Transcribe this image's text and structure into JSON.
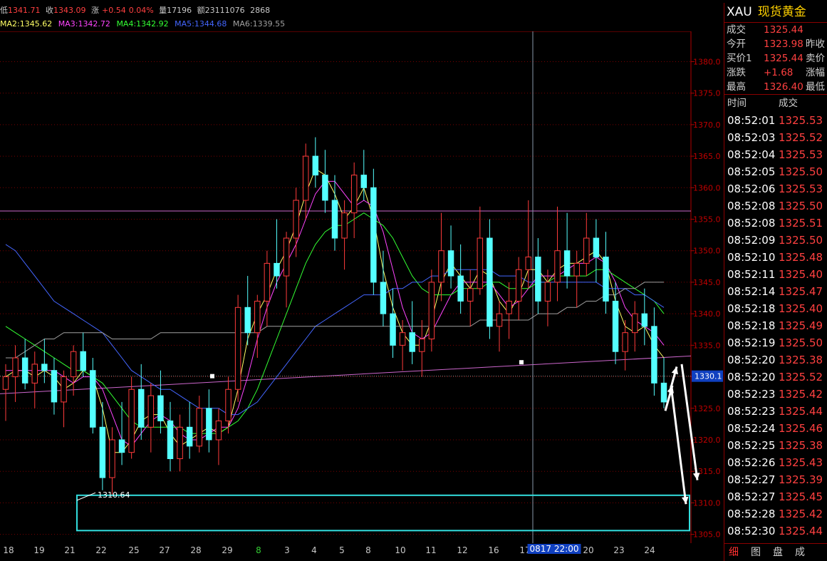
{
  "topbar": {
    "low_label": "低",
    "low_value": "1341.71",
    "close_label": "收",
    "close_value": "1343.09",
    "change_label": "涨",
    "change_value": "+0.54",
    "change_pct": "0.04%",
    "volume_label": "量",
    "volume_value": "17196",
    "amount_label": "额",
    "amount_value": "23111076",
    "extra_value": "2868"
  },
  "ma_bar": [
    {
      "label": "MA2:1345.62",
      "color": "#ffff66"
    },
    {
      "label": "MA3:1342.72",
      "color": "#ff44ff"
    },
    {
      "label": "MA4:1342.92",
      "color": "#33ff33"
    },
    {
      "label": "MA5:1344.68",
      "color": "#4466ff"
    },
    {
      "label": "MA6:1339.55",
      "color": "#a0a0a0"
    }
  ],
  "chart_data": {
    "type": "candlestick",
    "y_ticks": [
      1305.0,
      1310.0,
      1315.0,
      1320.0,
      1325.0,
      1330.0,
      1335.0,
      1340.0,
      1345.0,
      1350.0,
      1355.0,
      1360.0,
      1365.0,
      1370.0,
      1375.0,
      1380.0
    ],
    "ylim": [
      1303.6,
      1384.8
    ],
    "x_ticks": [
      "18",
      "19",
      "21",
      "22",
      "25",
      "27",
      "28",
      "29",
      "8",
      "3",
      "4",
      "5",
      "8",
      "10",
      "11",
      "12",
      "16",
      "17",
      "20",
      "23",
      "24"
    ],
    "x_tick_highlight": "8",
    "cursor_label": "0817 22:00",
    "current_price_label": "1330.1",
    "low_annotation": "1310.64",
    "candles": [
      [
        1328,
        1332,
        1323,
        1330
      ],
      [
        1330,
        1335,
        1326,
        1333
      ],
      [
        1333,
        1336,
        1328,
        1329
      ],
      [
        1329,
        1334,
        1325,
        1332
      ],
      [
        1332,
        1336,
        1329,
        1331
      ],
      [
        1331,
        1333,
        1324,
        1326
      ],
      [
        1326,
        1331,
        1322,
        1330
      ],
      [
        1330,
        1335,
        1327,
        1334
      ],
      [
        1334,
        1337,
        1330,
        1331
      ],
      [
        1331,
        1333,
        1321,
        1322
      ],
      [
        1322,
        1326,
        1312,
        1314
      ],
      [
        1314,
        1322,
        1311,
        1320
      ],
      [
        1320,
        1326,
        1316,
        1318
      ],
      [
        1318,
        1330,
        1317,
        1328
      ],
      [
        1328,
        1332,
        1320,
        1322
      ],
      [
        1322,
        1329,
        1318,
        1327
      ],
      [
        1327,
        1331,
        1321,
        1323
      ],
      [
        1323,
        1326,
        1315,
        1317
      ],
      [
        1317,
        1324,
        1315,
        1322
      ],
      [
        1322,
        1326,
        1317,
        1319
      ],
      [
        1319,
        1327,
        1318,
        1325
      ],
      [
        1325,
        1328,
        1318,
        1320
      ],
      [
        1320,
        1325,
        1316,
        1323
      ],
      [
        1323,
        1330,
        1321,
        1328
      ],
      [
        1328,
        1343,
        1326,
        1341
      ],
      [
        1341,
        1346,
        1335,
        1337
      ],
      [
        1337,
        1343,
        1333,
        1342
      ],
      [
        1342,
        1350,
        1338,
        1348
      ],
      [
        1348,
        1355,
        1344,
        1346
      ],
      [
        1346,
        1353,
        1341,
        1352
      ],
      [
        1352,
        1360,
        1349,
        1358
      ],
      [
        1358,
        1367,
        1355,
        1365
      ],
      [
        1365,
        1368,
        1360,
        1362
      ],
      [
        1362,
        1366,
        1356,
        1358
      ],
      [
        1358,
        1362,
        1350,
        1352
      ],
      [
        1352,
        1358,
        1347,
        1356
      ],
      [
        1356,
        1364,
        1352,
        1362
      ],
      [
        1362,
        1366,
        1358,
        1360
      ],
      [
        1360,
        1363,
        1343,
        1345
      ],
      [
        1345,
        1350,
        1338,
        1340
      ],
      [
        1340,
        1344,
        1333,
        1335
      ],
      [
        1335,
        1339,
        1331,
        1337
      ],
      [
        1337,
        1342,
        1332,
        1334
      ],
      [
        1334,
        1339,
        1330,
        1336
      ],
      [
        1336,
        1347,
        1334,
        1345
      ],
      [
        1345,
        1356,
        1342,
        1350
      ],
      [
        1350,
        1354,
        1344,
        1346
      ],
      [
        1346,
        1351,
        1340,
        1342
      ],
      [
        1342,
        1347,
        1338,
        1344
      ],
      [
        1344,
        1357,
        1343,
        1352
      ],
      [
        1352,
        1355,
        1336,
        1338
      ],
      [
        1338,
        1342,
        1334,
        1340
      ],
      [
        1340,
        1345,
        1336,
        1342
      ],
      [
        1342,
        1349,
        1339,
        1347
      ],
      [
        1347,
        1358,
        1344,
        1349
      ],
      [
        1349,
        1352,
        1340,
        1342
      ],
      [
        1342,
        1347,
        1338,
        1345
      ],
      [
        1345,
        1357,
        1342,
        1350
      ],
      [
        1350,
        1356,
        1344,
        1346
      ],
      [
        1346,
        1350,
        1341,
        1348
      ],
      [
        1348,
        1356,
        1346,
        1352
      ],
      [
        1352,
        1355,
        1345,
        1349
      ],
      [
        1349,
        1353,
        1340,
        1342
      ],
      [
        1342,
        1345,
        1332,
        1334
      ],
      [
        1334,
        1339,
        1331,
        1337
      ],
      [
        1337,
        1342,
        1334,
        1340
      ],
      [
        1340,
        1344,
        1335,
        1338
      ],
      [
        1338,
        1341,
        1327,
        1329
      ],
      [
        1329,
        1333,
        1325,
        1326
      ]
    ],
    "ma_series": [
      {
        "name": "MA2",
        "color": "#ffff66",
        "values": [
          1330,
          1331,
          1331,
          1330,
          1331,
          1330,
          1328,
          1329,
          1331,
          1330,
          1325,
          1318,
          1318,
          1320,
          1323,
          1324,
          1324,
          1321,
          1319,
          1320,
          1321,
          1322,
          1321,
          1322,
          1328,
          1336,
          1340,
          1343,
          1347,
          1350,
          1354,
          1359,
          1363,
          1362,
          1359,
          1355,
          1357,
          1360,
          1355,
          1347,
          1341,
          1337,
          1335,
          1335,
          1339,
          1345,
          1348,
          1346,
          1344,
          1347,
          1346,
          1342,
          1340,
          1343,
          1347,
          1347,
          1345,
          1347,
          1348,
          1348,
          1349,
          1350,
          1348,
          1342,
          1338,
          1337,
          1338,
          1335,
          1333
        ]
      },
      {
        "name": "MA3",
        "color": "#ff44ff",
        "values": [
          1331,
          1331,
          1331,
          1331,
          1331,
          1331,
          1330,
          1329,
          1330,
          1330,
          1328,
          1324,
          1320,
          1319,
          1321,
          1323,
          1324,
          1323,
          1321,
          1320,
          1320,
          1321,
          1322,
          1322,
          1325,
          1330,
          1336,
          1341,
          1345,
          1348,
          1351,
          1355,
          1359,
          1361,
          1361,
          1359,
          1357,
          1358,
          1357,
          1353,
          1347,
          1341,
          1337,
          1336,
          1337,
          1340,
          1343,
          1345,
          1345,
          1345,
          1345,
          1343,
          1341,
          1342,
          1344,
          1346,
          1346,
          1346,
          1347,
          1348,
          1348,
          1349,
          1348,
          1345,
          1341,
          1339,
          1338,
          1337,
          1335
        ]
      },
      {
        "name": "MA4",
        "color": "#33ff33",
        "values": [
          1338,
          1337,
          1336,
          1335,
          1334,
          1333,
          1332,
          1331,
          1331,
          1330,
          1329,
          1327,
          1325,
          1323,
          1322,
          1322,
          1322,
          1322,
          1322,
          1321,
          1321,
          1321,
          1321,
          1322,
          1323,
          1325,
          1328,
          1332,
          1336,
          1340,
          1344,
          1348,
          1351,
          1353,
          1354,
          1354,
          1355,
          1356,
          1355,
          1354,
          1352,
          1349,
          1346,
          1344,
          1343,
          1343,
          1343,
          1344,
          1344,
          1344,
          1345,
          1345,
          1344,
          1344,
          1344,
          1345,
          1345,
          1346,
          1346,
          1346,
          1346,
          1347,
          1347,
          1346,
          1345,
          1344,
          1343,
          1342,
          1340
        ]
      },
      {
        "name": "MA5",
        "color": "#4466ff",
        "values": [
          1351,
          1350,
          1348,
          1346,
          1344,
          1342,
          1341,
          1340,
          1339,
          1338,
          1337,
          1335,
          1333,
          1331,
          1330,
          1329,
          1328,
          1328,
          1327,
          1326,
          1325,
          1325,
          1325,
          1324,
          1324,
          1325,
          1326,
          1328,
          1330,
          1332,
          1334,
          1336,
          1338,
          1339,
          1340,
          1341,
          1342,
          1343,
          1343,
          1343,
          1344,
          1344,
          1345,
          1345,
          1346,
          1346,
          1347,
          1347,
          1347,
          1347,
          1347,
          1346,
          1346,
          1346,
          1345,
          1345,
          1345,
          1345,
          1345,
          1345,
          1345,
          1345,
          1344,
          1344,
          1344,
          1343,
          1343,
          1342,
          1341
        ]
      },
      {
        "name": "MA6",
        "color": "#a0a0a0",
        "values": [
          1333,
          1333,
          1334,
          1335,
          1336,
          1336,
          1337,
          1337,
          1337,
          1337,
          1337,
          1336,
          1336,
          1336,
          1336,
          1336,
          1337,
          1337,
          1337,
          1337,
          1337,
          1337,
          1337,
          1337,
          1337,
          1337,
          1337,
          1338,
          1338,
          1338,
          1338,
          1338,
          1338,
          1338,
          1338,
          1338,
          1338,
          1338,
          1338,
          1338,
          1338,
          1338,
          1338,
          1338,
          1338,
          1338,
          1338,
          1338,
          1338,
          1339,
          1339,
          1339,
          1339,
          1339,
          1339,
          1340,
          1340,
          1340,
          1341,
          1341,
          1342,
          1342,
          1343,
          1343,
          1344,
          1344,
          1345,
          1345,
          1345
        ]
      }
    ]
  },
  "right_panel": {
    "code": "XAU",
    "name": "现货黄金",
    "quotes": [
      {
        "k": "成交",
        "v": "1325.44",
        "k2": ""
      },
      {
        "k": "今开",
        "v": "1323.98",
        "k2": "昨收"
      },
      {
        "k": "买价1",
        "v": "1325.44",
        "k2": "卖价"
      },
      {
        "k": "涨跌",
        "v": "+1.68",
        "k2": "涨幅"
      },
      {
        "k": "最高",
        "v": "1326.40",
        "k2": "最低"
      }
    ],
    "ticks_header": {
      "time": "时间",
      "price": "成交"
    },
    "ticks": [
      {
        "t": "08:52:01",
        "p": "1325.53"
      },
      {
        "t": "08:52:03",
        "p": "1325.52"
      },
      {
        "t": "08:52:04",
        "p": "1325.53"
      },
      {
        "t": "08:52:05",
        "p": "1325.50"
      },
      {
        "t": "08:52:06",
        "p": "1325.53"
      },
      {
        "t": "08:52:08",
        "p": "1325.50"
      },
      {
        "t": "08:52:08",
        "p": "1325.51"
      },
      {
        "t": "08:52:09",
        "p": "1325.50"
      },
      {
        "t": "08:52:10",
        "p": "1325.48"
      },
      {
        "t": "08:52:11",
        "p": "1325.40"
      },
      {
        "t": "08:52:14",
        "p": "1325.47"
      },
      {
        "t": "08:52:18",
        "p": "1325.40"
      },
      {
        "t": "08:52:18",
        "p": "1325.49"
      },
      {
        "t": "08:52:19",
        "p": "1325.50"
      },
      {
        "t": "08:52:20",
        "p": "1325.38"
      },
      {
        "t": "08:52:20",
        "p": "1325.52"
      },
      {
        "t": "08:52:23",
        "p": "1325.42"
      },
      {
        "t": "08:52:23",
        "p": "1325.44"
      },
      {
        "t": "08:52:24",
        "p": "1325.46"
      },
      {
        "t": "08:52:25",
        "p": "1325.38"
      },
      {
        "t": "08:52:26",
        "p": "1325.43"
      },
      {
        "t": "08:52:27",
        "p": "1325.39"
      },
      {
        "t": "08:52:27",
        "p": "1325.45"
      },
      {
        "t": "08:52:28",
        "p": "1325.42"
      },
      {
        "t": "08:52:30",
        "p": "1325.44"
      }
    ],
    "tabs": [
      "细",
      "图",
      "盘",
      "成"
    ],
    "active_tab": 0
  }
}
